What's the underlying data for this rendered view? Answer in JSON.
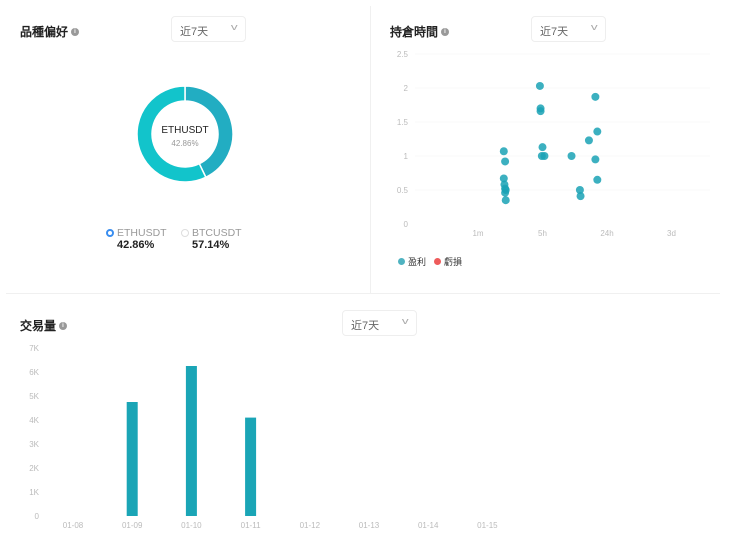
{
  "variety": {
    "title": "品種偏好",
    "range_select": "近7天",
    "center_label": "ETHUSDT",
    "center_value": "42.86%",
    "colors": {
      "ETHUSDT": "#22adc2",
      "BTCUSDT": "#12c4cb"
    },
    "legend": [
      {
        "name": "ETHUSDT",
        "value": "42.86%",
        "selected": true
      },
      {
        "name": "BTCUSDT",
        "value": "57.14%",
        "selected": false
      }
    ]
  },
  "holding": {
    "title": "持倉時間",
    "range_select": "近7天",
    "legend": [
      {
        "name": "盈利",
        "color": "#4fb3c1"
      },
      {
        "name": "虧損",
        "color": "#ee5b5b"
      }
    ]
  },
  "volume": {
    "title": "交易量",
    "range_select": "近7天"
  },
  "chart_data": [
    {
      "type": "pie",
      "title": "品種偏好",
      "labels": [
        "ETHUSDT",
        "BTCUSDT"
      ],
      "values": [
        42.86,
        57.14
      ]
    },
    {
      "type": "scatter",
      "title": "持倉時間",
      "x_tick_labels": [
        "1m",
        "5h",
        "24h",
        "3d"
      ],
      "xlim": [
        -0.7,
        3
      ],
      "y_ticks": [
        "0",
        "0.5",
        "1",
        "1.5",
        "2",
        "2.5"
      ],
      "ylim": [
        0,
        2.5
      ],
      "series": [
        {
          "name": "盈利",
          "points": [
            [
              0.4,
              1.07
            ],
            [
              0.42,
              0.92
            ],
            [
              0.4,
              0.67
            ],
            [
              0.41,
              0.58
            ],
            [
              0.42,
              0.52
            ],
            [
              0.43,
              0.5
            ],
            [
              0.42,
              0.46
            ],
            [
              0.43,
              0.35
            ],
            [
              0.96,
              2.03
            ],
            [
              0.97,
              1.7
            ],
            [
              0.97,
              1.66
            ],
            [
              1.0,
              1.13
            ],
            [
              0.99,
              1.0
            ],
            [
              1.03,
              1.0
            ],
            [
              1.45,
              1.0
            ],
            [
              1.58,
              0.5
            ],
            [
              1.59,
              0.41
            ],
            [
              1.72,
              1.23
            ],
            [
              1.82,
              1.87
            ],
            [
              1.82,
              0.95
            ],
            [
              1.85,
              1.36
            ],
            [
              1.85,
              0.65
            ]
          ]
        },
        {
          "name": "虧損",
          "points": []
        }
      ]
    },
    {
      "type": "bar",
      "title": "交易量",
      "categories": [
        "01-08",
        "01-09",
        "01-10",
        "01-11",
        "01-12",
        "01-13",
        "01-14",
        "01-15"
      ],
      "values": [
        0,
        4750,
        6250,
        4100,
        0,
        0,
        0,
        0
      ],
      "y_ticks": [
        "0",
        "1K",
        "2K",
        "3K",
        "4K",
        "5K",
        "6K",
        "7K"
      ],
      "ylim": [
        0,
        7000
      ],
      "color": "#1aa5b6"
    }
  ]
}
